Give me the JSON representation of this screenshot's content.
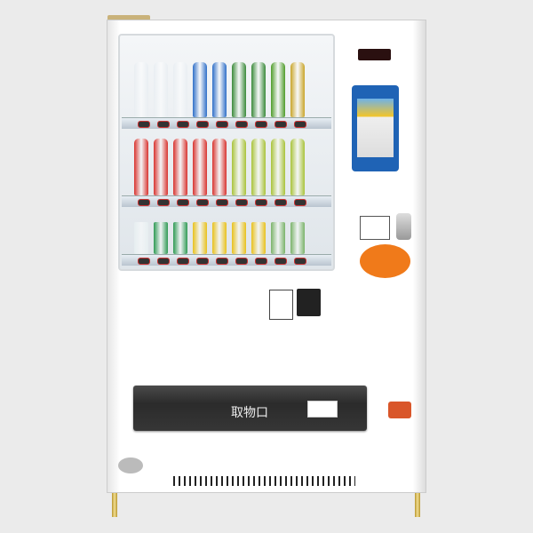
{
  "machine": {
    "pickup_label": "取物口",
    "shelves": [
      {
        "colors": [
          "#e9eef2",
          "#e9eef2",
          "#e9eef2",
          "#2f6fc8",
          "#2f6fc8",
          "#3a8a3a",
          "#3a8a3a",
          "#4f9c2a",
          "#c9a52a"
        ]
      },
      {
        "colors": [
          "#d8342f",
          "#d8342f",
          "#d8342f",
          "#d8342f",
          "#d8342f",
          "#a9c33a",
          "#a9c33a",
          "#a9c33a",
          "#a9c33a"
        ]
      },
      {
        "colors": [
          "#e6eef0",
          "#2f9a54",
          "#2f9a54",
          "#e8c11c",
          "#e8c11c",
          "#e8c11c",
          "#e8c11c",
          "#7bb36a",
          "#7bb36a"
        ]
      }
    ],
    "accent": "#f07a1a"
  }
}
